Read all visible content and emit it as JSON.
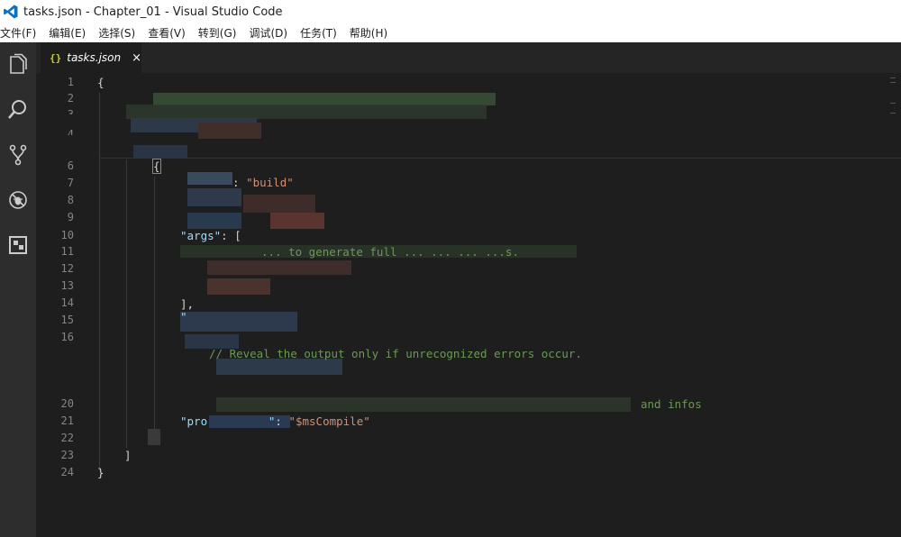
{
  "window": {
    "title": "tasks.json - Chapter_01 - Visual Studio Code"
  },
  "menu": [
    "文件(F)",
    "编辑(E)",
    "选择(S)",
    "查看(V)",
    "转到(G)",
    "调试(D)",
    "任务(T)",
    "帮助(H)"
  ],
  "activity_icons": [
    "explorer-icon",
    "search-icon",
    "source-control-icon",
    "debug-icon",
    "extensions-icon"
  ],
  "tab": {
    "icon": "{}",
    "label": "tasks.json",
    "close": "×"
  },
  "line_numbers": [
    "1",
    "2",
    "3",
    "4",
    "6",
    "7",
    "8",
    "9",
    "10",
    "11",
    "12",
    "13",
    "14",
    "15",
    "16",
    "20",
    "21",
    "22",
    "23",
    "24"
  ],
  "code": {
    "l1": "{",
    "l6": "{",
    "l7_value": "\"build\"",
    "l10_key": "\"args\"",
    "l10_rest": ": [",
    "l11_comment": "... to generate full ... ... ... ...s.",
    "l14": "],",
    "l15": "\"",
    "l16_comment": "// Reveal the output only if unrecognized errors occur.",
    "l20_comment": "and infos",
    "l21_key": "\"pro",
    "l21_value": "\"$msCompile\"",
    "l23": "]",
    "l24": "}"
  },
  "colors": {
    "editor_bg": "#1e1e1e",
    "activity_bg": "#2d2d2d",
    "string": "#ce9178",
    "key": "#9cdcfe",
    "comment": "#6a9955",
    "line_number": "#858585"
  }
}
